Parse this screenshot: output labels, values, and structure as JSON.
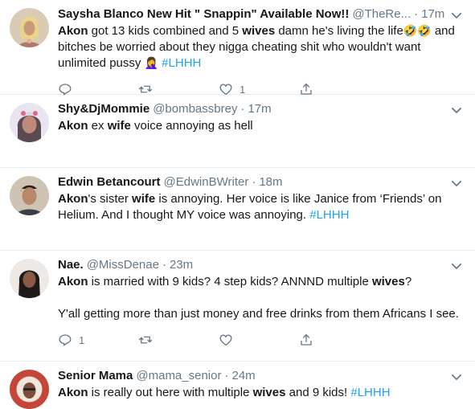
{
  "tweets": [
    {
      "name": "Saysha Blanco New Hit \" Snappin\" Available Now!!",
      "handle": "@TheRe...",
      "time": "17m",
      "segments": [
        {
          "t": "Akon",
          "k": "kw"
        },
        {
          "t": " got 13 kids combined and 5 "
        },
        {
          "t": "wives",
          "k": "kw"
        },
        {
          "t": " damn he's living the life"
        },
        {
          "t": "🤣🤣",
          "k": "emoji"
        },
        {
          "t": " and bitches be worried about they nigga cheating shit who wouldn't want unlimited pussy "
        },
        {
          "t": "🤦‍♀️",
          "k": "emoji"
        },
        {
          "t": " "
        },
        {
          "t": "#LHHH",
          "k": "tag"
        }
      ],
      "reply_count": "",
      "retweet_count": "",
      "like_count": "1",
      "show_actions": true
    },
    {
      "name": "Shy&DjMommie",
      "handle": "@bombassbrey",
      "time": "17m",
      "segments": [
        {
          "t": "Akon",
          "k": "kw"
        },
        {
          "t": " ex "
        },
        {
          "t": "wife",
          "k": "kw"
        },
        {
          "t": " voice annoying as hell"
        }
      ],
      "show_actions": false
    },
    {
      "name": "Edwin Betancourt",
      "handle": "@EdwinBWriter",
      "time": "18m",
      "segments": [
        {
          "t": "Akon",
          "k": "kw"
        },
        {
          "t": "'s sister "
        },
        {
          "t": "wife",
          "k": "kw"
        },
        {
          "t": " is annoying. Her voice is like Janice from ‘Friends’ on Helium. And I thought MY voice was annoying. "
        },
        {
          "t": "#LHHH",
          "k": "tag"
        }
      ],
      "show_actions": false
    },
    {
      "name": "Nae.",
      "handle": "@MissDenae",
      "time": "23m",
      "segments": [
        {
          "t": "Akon",
          "k": "kw"
        },
        {
          "t": " is married with 9 kids? 4 step kids? ANNND multiple "
        },
        {
          "t": "wives",
          "k": "kw"
        },
        {
          "t": "?"
        }
      ],
      "paragraph2": "Y'all getting more than just money and free drinks from them Africans I see.",
      "reply_count": "1",
      "retweet_count": "",
      "like_count": "",
      "show_actions": true
    },
    {
      "name": "Senior Mama",
      "handle": "@mama_senior",
      "time": "24m",
      "segments": [
        {
          "t": "Akon",
          "k": "kw"
        },
        {
          "t": " is really out here with multiple "
        },
        {
          "t": "wives",
          "k": "kw"
        },
        {
          "t": " and 9 kids! "
        },
        {
          "t": "#LHHH",
          "k": "tag"
        }
      ],
      "show_actions": false
    }
  ],
  "separator": "·",
  "colors": {
    "accent": "#1da1f2",
    "text": "#14171a",
    "muted": "#657786",
    "divider": "#e6ecf0"
  },
  "icons": [
    "chevron-down-icon",
    "reply-icon",
    "retweet-icon",
    "like-icon",
    "share-icon"
  ]
}
